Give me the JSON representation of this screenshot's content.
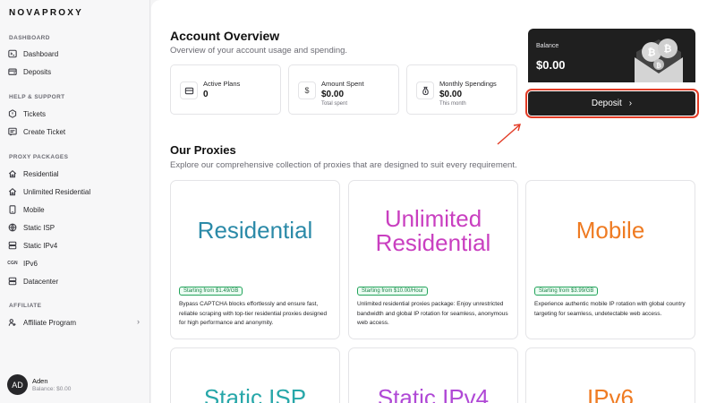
{
  "brand": "NOVAPROXY",
  "sidebar": {
    "sections": [
      {
        "title": "DASHBOARD",
        "items": [
          {
            "label": "Dashboard",
            "icon": "terminal-icon"
          },
          {
            "label": "Deposits",
            "icon": "wallet-icon"
          }
        ]
      },
      {
        "title": "HELP & SUPPORT",
        "items": [
          {
            "label": "Tickets",
            "icon": "ticket-icon"
          },
          {
            "label": "Create Ticket",
            "icon": "create-ticket-icon"
          }
        ]
      },
      {
        "title": "PROXY PACKAGES",
        "items": [
          {
            "label": "Residential",
            "icon": "house-icon"
          },
          {
            "label": "Unlimited Residential",
            "icon": "house-icon"
          },
          {
            "label": "Mobile",
            "icon": "phone-icon"
          },
          {
            "label": "Static ISP",
            "icon": "globe-icon"
          },
          {
            "label": "Static IPv4",
            "icon": "server-icon"
          },
          {
            "label": "IPv6",
            "icon": "ipv6-icon",
            "icon_text": "CGN"
          },
          {
            "label": "Datacenter",
            "icon": "database-icon"
          }
        ]
      },
      {
        "title": "AFFILIATE",
        "items": [
          {
            "label": "Affiliate Program",
            "icon": "affiliate-icon",
            "chevron": "›"
          }
        ]
      }
    ]
  },
  "user": {
    "initials": "AD",
    "name": "Aden",
    "balance": "Balance: $0.00"
  },
  "overview": {
    "title": "Account Overview",
    "subtitle": "Overview of your account usage and spending.",
    "stats": [
      {
        "label": "Active Plans",
        "value": "0",
        "note": "",
        "icon": "card-icon"
      },
      {
        "label": "Amount Spent",
        "value": "$0.00",
        "note": "Total spent",
        "icon": "dollar-icon"
      },
      {
        "label": "Monthly Spendings",
        "value": "$0.00",
        "note": "This month",
        "icon": "money-bag-icon"
      }
    ]
  },
  "balance": {
    "label": "Balance",
    "value": "$0.00",
    "deposit_label": "Deposit",
    "deposit_chevron": "›"
  },
  "proxies": {
    "title": "Our Proxies",
    "subtitle": "Explore our comprehensive collection of proxies that are designed to suit every requirement.",
    "cards": [
      {
        "name_lines": [
          "Residential"
        ],
        "color": "#2b8aa8",
        "badge": "Starting from $1.49/GB",
        "desc": "Bypass CAPTCHA blocks effortlessly and ensure fast, reliable scraping with top-tier residential proxies designed for high performance and anonymity."
      },
      {
        "name_lines": [
          "Unlimited",
          "Residential"
        ],
        "color": "#c93fc0",
        "badge": "Starting from $10.00/Hour",
        "desc": "Unlimited residential proxies package: Enjoy unrestricted bandwidth and global IP rotation for seamless, anonymous web access."
      },
      {
        "name_lines": [
          "Mobile"
        ],
        "color": "#ef7b22",
        "badge": "Starting from $3.99/GB",
        "desc": "Experience authentic mobile IP rotation with global country targeting for seamless, undetectable web access."
      },
      {
        "name_lines": [
          "Static ISP"
        ],
        "color": "#27a7a9"
      },
      {
        "name_lines": [
          "Static IPv4"
        ],
        "color": "#b049d6"
      },
      {
        "name_lines": [
          "IPv6"
        ],
        "color": "#ef7b22"
      }
    ]
  }
}
